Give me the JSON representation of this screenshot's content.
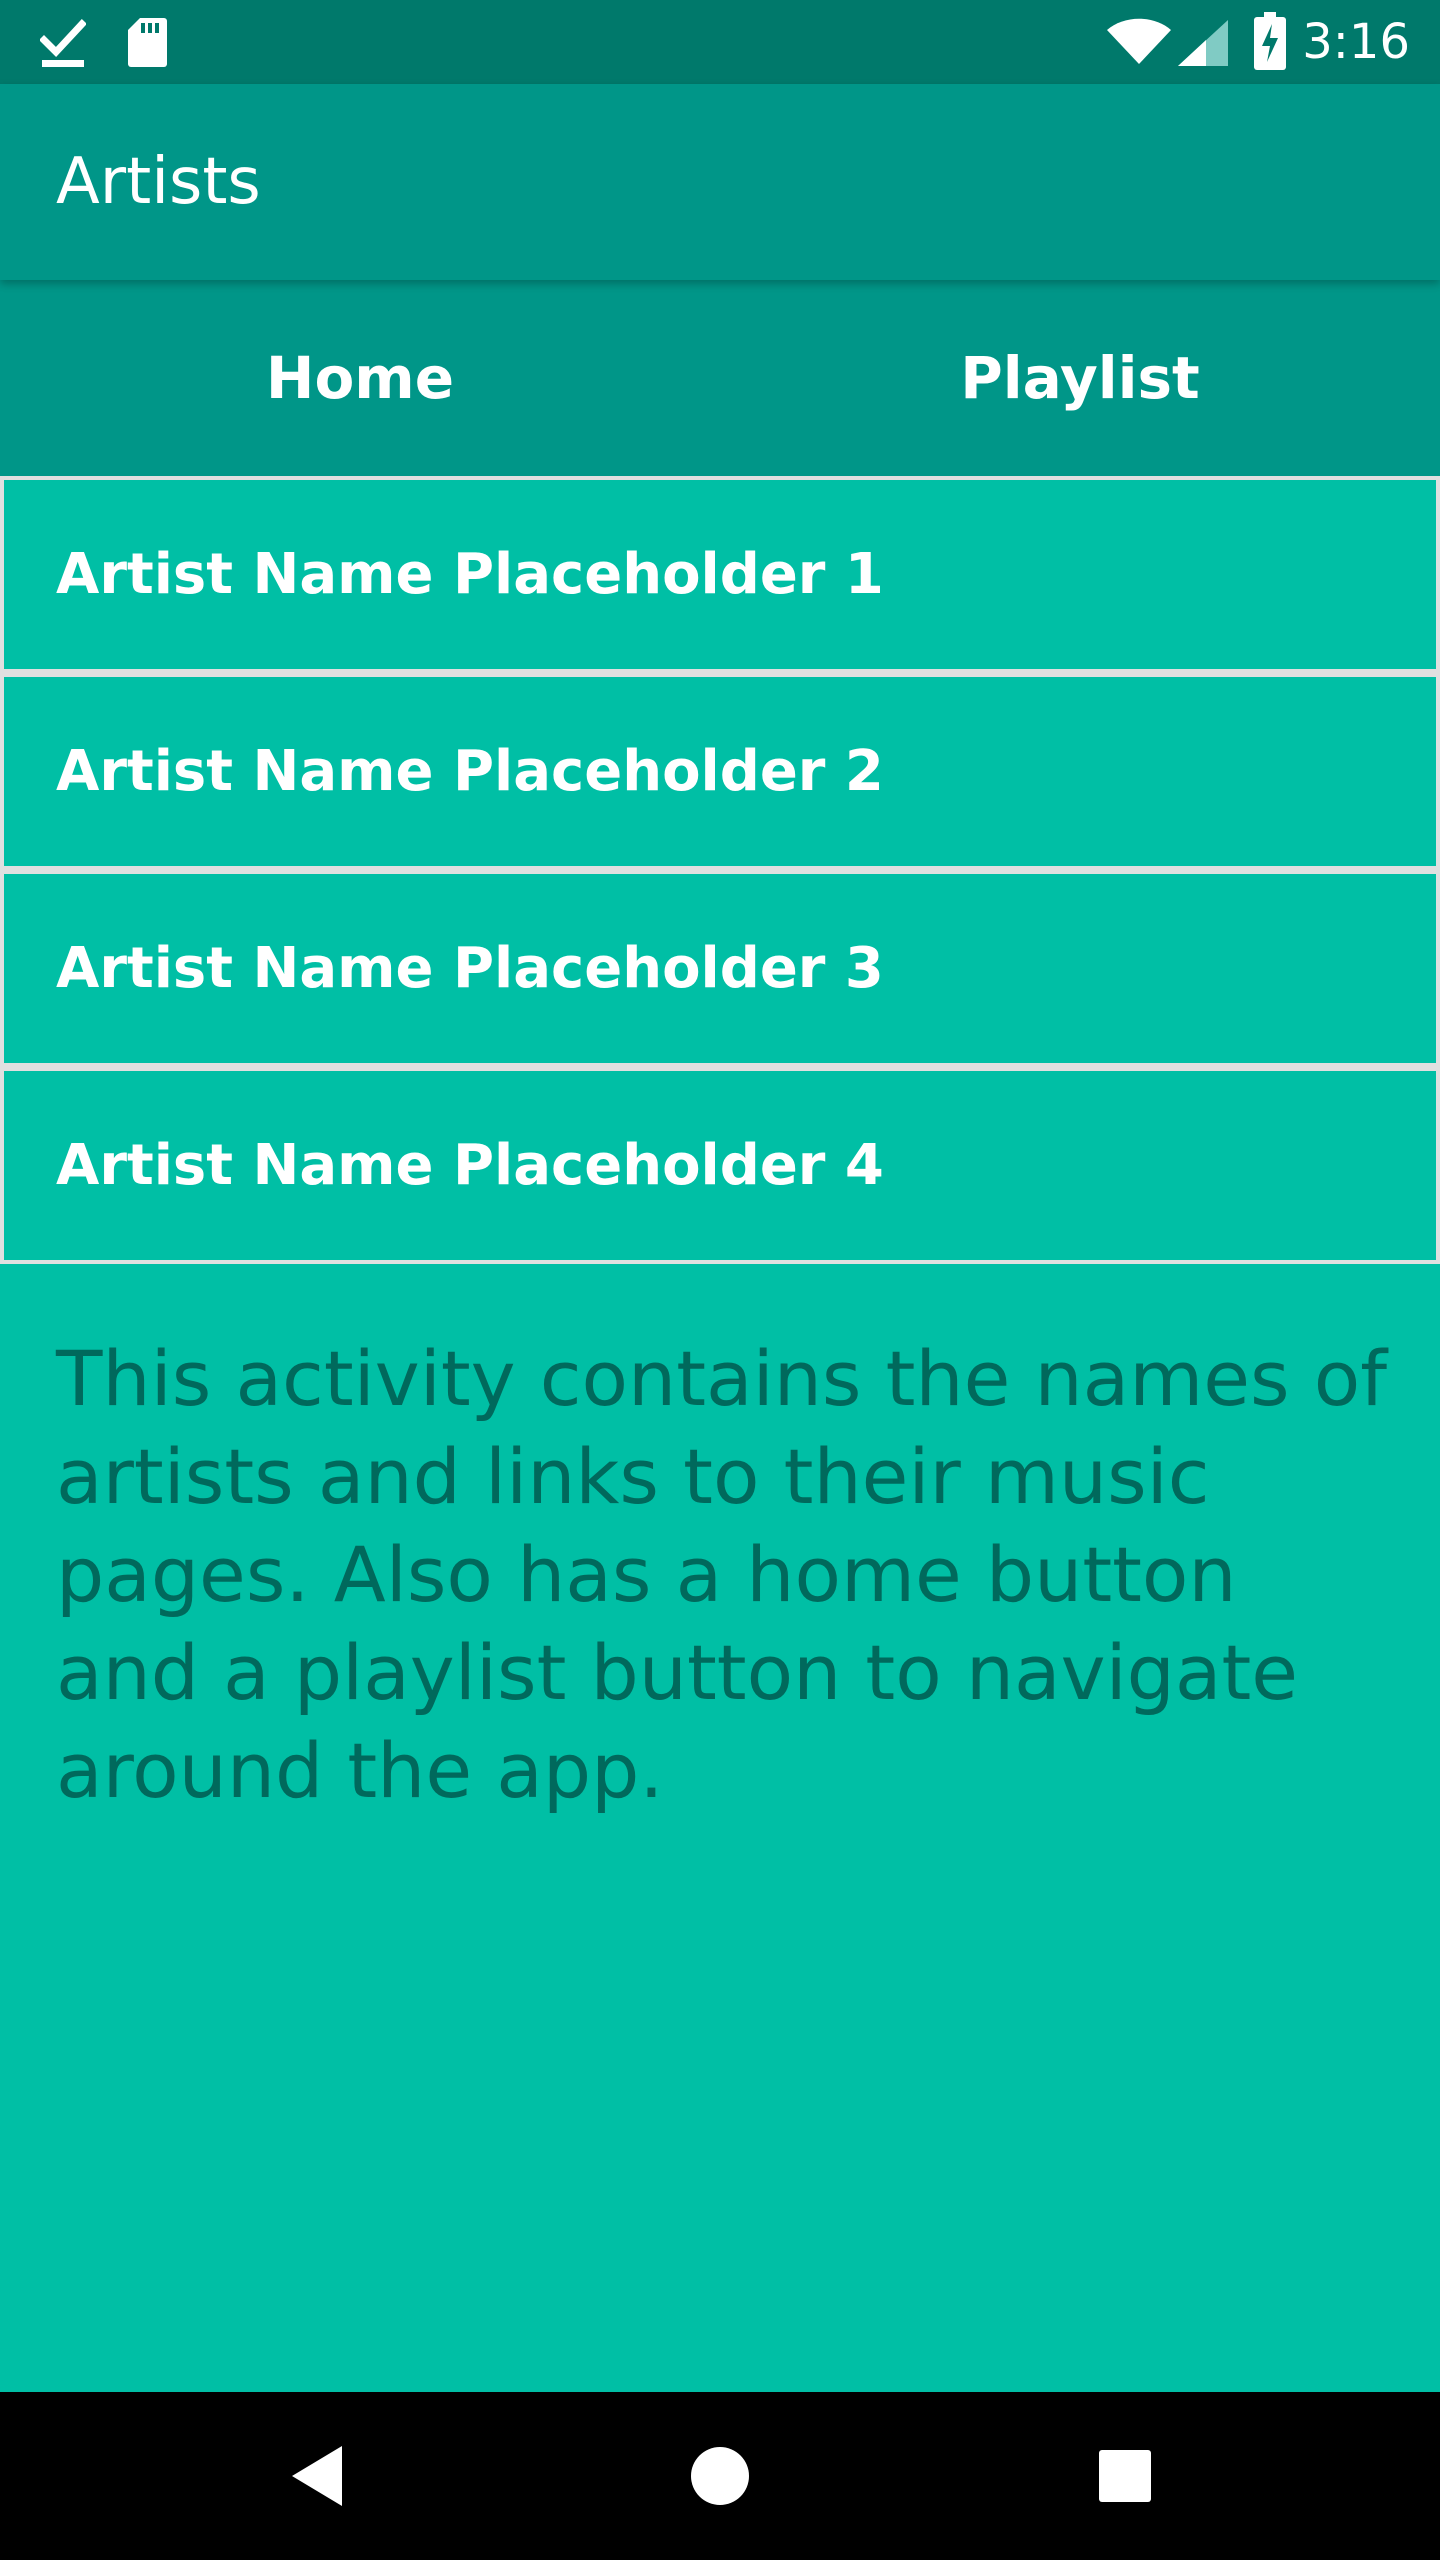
{
  "status_bar": {
    "time": "3:16",
    "left_icons": [
      "download-done-icon",
      "sd-card-icon"
    ],
    "right_icons": [
      "wifi-icon",
      "cellular-signal-icon",
      "battery-charging-icon"
    ]
  },
  "app_bar": {
    "title": "Artists"
  },
  "nav": {
    "home_label": "Home",
    "playlist_label": "Playlist"
  },
  "artists": [
    {
      "label": "Artist Name Placeholder 1"
    },
    {
      "label": "Artist Name Placeholder 2"
    },
    {
      "label": "Artist Name Placeholder 3"
    },
    {
      "label": "Artist Name Placeholder 4"
    }
  ],
  "description": "This activity contains the names of artists and links to their music pages. Also has a home button and a playlist button to navigate around the app.",
  "system_nav": {
    "icons": [
      "back-icon",
      "home-circle-icon",
      "recents-icon"
    ]
  },
  "colors": {
    "status_bar": "#00796B",
    "app_bar": "#009688",
    "background": "#00BFA5",
    "item_border": "#E0E0E0",
    "description_text": "#00695C"
  }
}
